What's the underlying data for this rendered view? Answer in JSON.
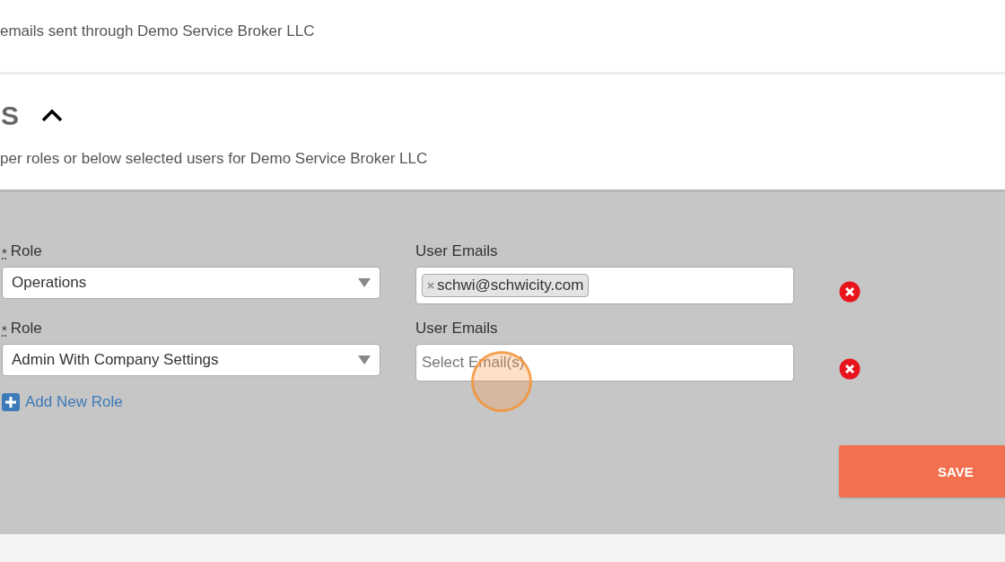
{
  "notice": {
    "text": "emails sent through Demo Service Broker LLC"
  },
  "section": {
    "title": "S",
    "expanded": true,
    "description": "per roles or below selected users for Demo Service Broker LLC"
  },
  "role_rows": [
    {
      "required_mark": "*",
      "role_label": "Role",
      "role": "Operations",
      "emails_label": "User Emails",
      "emails": [
        "schwi@schwicity.com"
      ]
    },
    {
      "required_mark": "*",
      "role_label": "Role",
      "role": "Admin With Company Settings",
      "emails_label": "User Emails",
      "emails": [],
      "placeholder": "Select Email(s)"
    }
  ],
  "add_role": {
    "label": "Add New Role"
  },
  "save_button": {
    "label": "SAVE"
  },
  "click_indicator": {
    "visible": true
  }
}
